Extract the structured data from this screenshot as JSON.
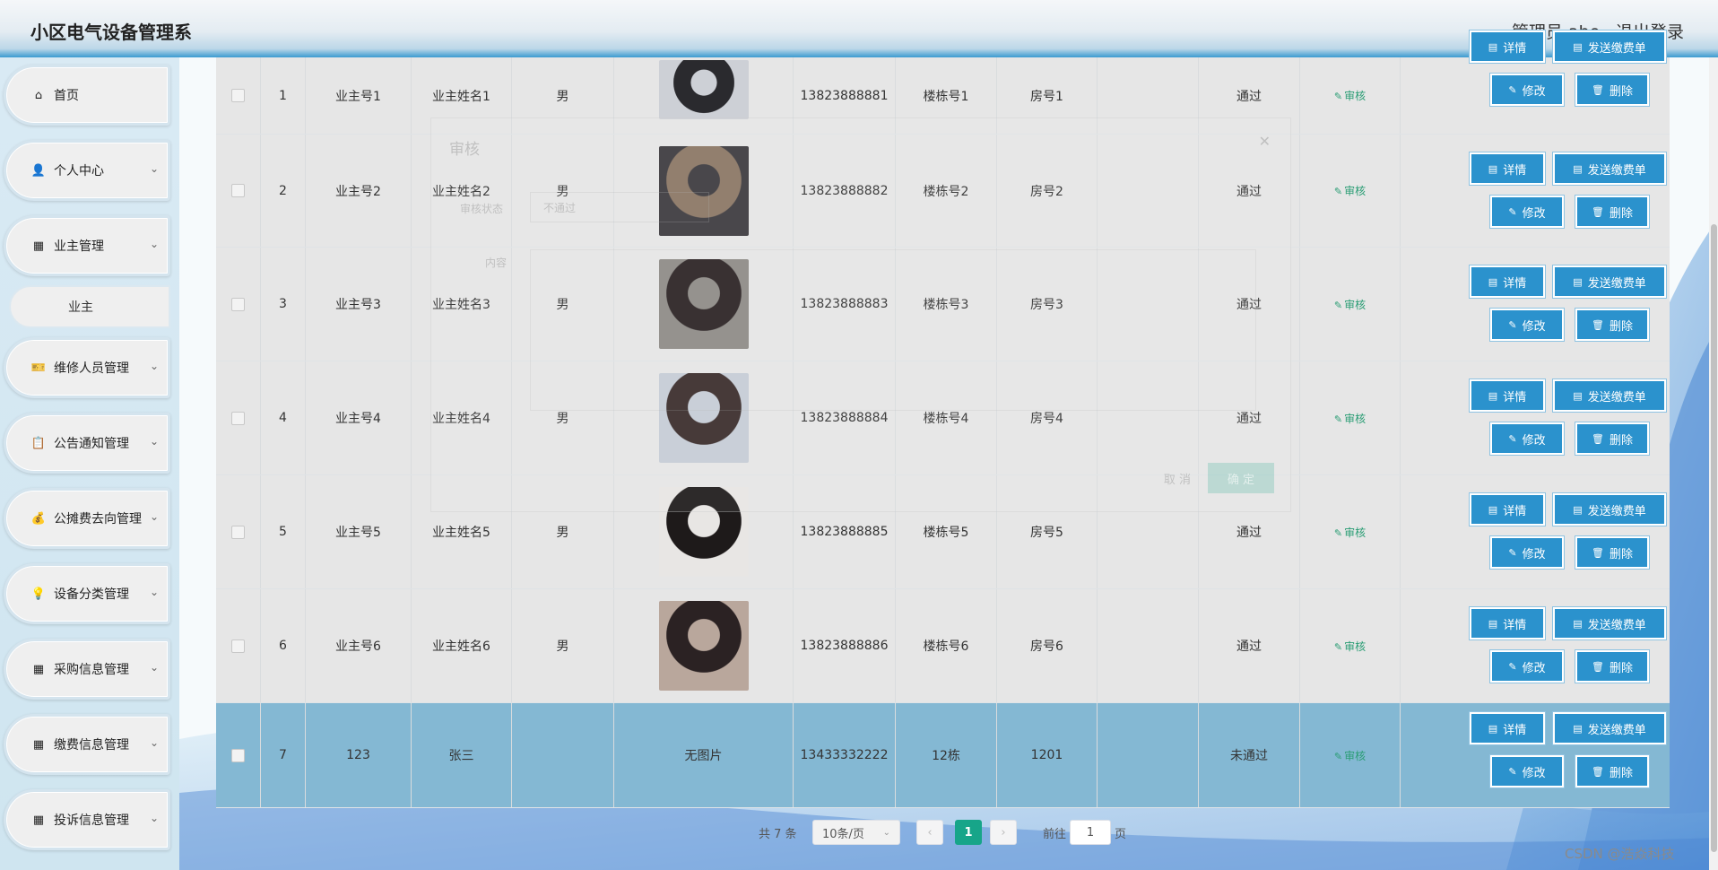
{
  "header": {
    "title": "小区电气设备管理系",
    "user_label": "管理员 abo",
    "logout": "退出登录"
  },
  "sidebar": {
    "items": [
      {
        "label": "首页",
        "icon": "home-icon",
        "glyph": "⌂",
        "chevron": false
      },
      {
        "label": "个人中心",
        "icon": "user-icon",
        "glyph": "👤",
        "chevron": true
      },
      {
        "label": "业主管理",
        "icon": "grid-icon",
        "glyph": "▦",
        "chevron": true
      },
      {
        "label": "维修人员管理",
        "icon": "ticket-icon",
        "glyph": "🎫",
        "chevron": true
      },
      {
        "label": "公告通知管理",
        "icon": "clipboard-icon",
        "glyph": "📋",
        "chevron": true
      },
      {
        "label": "公摊费去向管理",
        "icon": "coins-icon",
        "glyph": "💰",
        "chevron": true
      },
      {
        "label": "设备分类管理",
        "icon": "bulb-icon",
        "glyph": "💡",
        "chevron": true
      },
      {
        "label": "采购信息管理",
        "icon": "grid-icon",
        "glyph": "▦",
        "chevron": true
      },
      {
        "label": "缴费信息管理",
        "icon": "grid-icon",
        "glyph": "▦",
        "chevron": true
      },
      {
        "label": "投诉信息管理",
        "icon": "grid-icon",
        "glyph": "▦",
        "chevron": true
      }
    ],
    "submenu": {
      "label": "业主"
    }
  },
  "table": {
    "rows": [
      {
        "index": "1",
        "owner_no": "业主号1",
        "owner_name": "业主姓名1",
        "gender": "男",
        "photo": "photo",
        "phone": "13823888881",
        "building": "楼栋号1",
        "room": "房号1",
        "remark": "",
        "status": "通过",
        "highlight": false
      },
      {
        "index": "2",
        "owner_no": "业主号2",
        "owner_name": "业主姓名2",
        "gender": "男",
        "photo": "photo",
        "phone": "13823888882",
        "building": "楼栋号2",
        "room": "房号2",
        "remark": "",
        "status": "通过",
        "highlight": false
      },
      {
        "index": "3",
        "owner_no": "业主号3",
        "owner_name": "业主姓名3",
        "gender": "男",
        "photo": "photo",
        "phone": "13823888883",
        "building": "楼栋号3",
        "room": "房号3",
        "remark": "",
        "status": "通过",
        "highlight": false
      },
      {
        "index": "4",
        "owner_no": "业主号4",
        "owner_name": "业主姓名4",
        "gender": "男",
        "photo": "photo",
        "phone": "13823888884",
        "building": "楼栋号4",
        "room": "房号4",
        "remark": "",
        "status": "通过",
        "highlight": false
      },
      {
        "index": "5",
        "owner_no": "业主号5",
        "owner_name": "业主姓名5",
        "gender": "男",
        "photo": "photo",
        "phone": "13823888885",
        "building": "楼栋号5",
        "room": "房号5",
        "remark": "",
        "status": "通过",
        "highlight": false
      },
      {
        "index": "6",
        "owner_no": "业主号6",
        "owner_name": "业主姓名6",
        "gender": "男",
        "photo": "photo",
        "phone": "13823888886",
        "building": "楼栋号6",
        "room": "房号6",
        "remark": "",
        "status": "通过",
        "highlight": false
      },
      {
        "index": "7",
        "owner_no": "123",
        "owner_name": "张三",
        "gender": "",
        "photo": "无图片",
        "phone": "13433332222",
        "building": "12栋",
        "room": "1201",
        "remark": "",
        "status": "未通过",
        "highlight": true
      }
    ],
    "audit_label": "审核",
    "actions": {
      "detail": "详情",
      "send_bill": "发送缴费单",
      "edit": "修改",
      "delete": "删除"
    }
  },
  "modal": {
    "title": "审核",
    "status_label": "审核状态",
    "status_value": "不通过",
    "content_label": "内容",
    "cancel": "取 消",
    "confirm": "确 定"
  },
  "pagination": {
    "total": "共 7 条",
    "page_size": "10条/页",
    "current_page": "1",
    "goto_label": "前往",
    "goto_value": "1",
    "page_suffix": "页"
  },
  "watermark": "CSDN @浩焱科技",
  "colors": {
    "primary_button": "#2b92cd",
    "highlight_row": "#84b8d3",
    "audit_green": "#2a9d74",
    "pager_active": "#17a589"
  }
}
